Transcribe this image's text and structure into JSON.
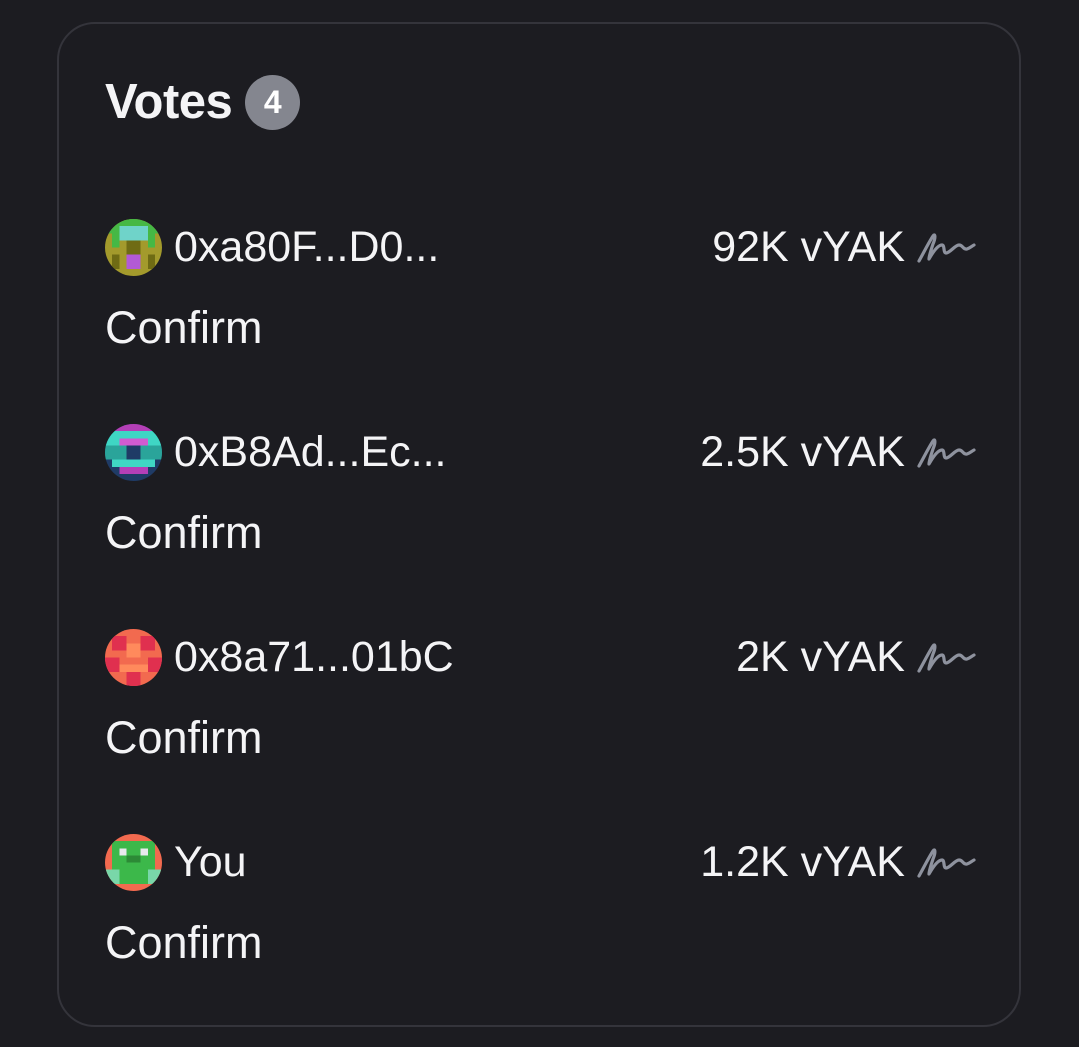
{
  "votes_panel": {
    "title": "Votes",
    "count": "4",
    "votes": [
      {
        "voter": "0xa80F...D0...",
        "avatar_icon": "pixel-avatar-green-olive",
        "power": "92K vYAK",
        "choice": "Confirm",
        "signature_icon": "signature-icon"
      },
      {
        "voter": "0xB8Ad...Ec...",
        "avatar_icon": "pixel-avatar-teal-navy",
        "power": "2.5K vYAK",
        "choice": "Confirm",
        "signature_icon": "signature-icon"
      },
      {
        "voter": "0x8a71...01bC",
        "avatar_icon": "pixel-avatar-coral-red",
        "power": "2K vYAK",
        "choice": "Confirm",
        "signature_icon": "signature-icon"
      },
      {
        "voter": "You",
        "avatar_icon": "pixel-avatar-green-coral",
        "power": "1.2K vYAK",
        "choice": "Confirm",
        "signature_icon": "signature-icon"
      }
    ]
  },
  "colors": {
    "background": "#1c1c21",
    "card_border": "#34343b",
    "text": "#f4f4f6",
    "badge": "#84868f",
    "signature": "#8e929e"
  }
}
